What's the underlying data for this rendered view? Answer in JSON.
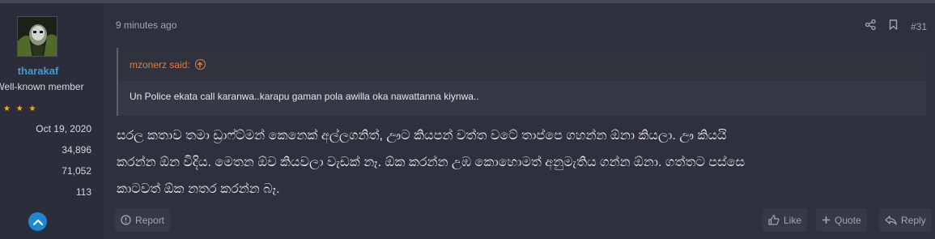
{
  "user": {
    "username": "tharakaf",
    "title": "Well-known member",
    "stars": "★ ★ ★",
    "joined": "Oct 19, 2020",
    "messages": "34,896",
    "reactions": "71,052",
    "points": "113"
  },
  "post": {
    "timestamp": "9 minutes ago",
    "number": "#31",
    "quote": {
      "author": "mzonerz said:",
      "text": "Un Police ekata call karanwa..karapu gaman pola awilla oka nawattanna kiynwa.."
    },
    "body_line1": "සරල කතාව තමා ඩ්‍රාෆ්ට්මන් කෙනෙක් අල්ලගනිත්, ඌට කියපන් වත්ත වටේ තාප්පෙ ගහන්න ඕනා කියලා. ඌ කියයි",
    "body_line2": "කරන්න ඕන විදිය. මෙතන ඕව කියවලා වැඩක් නෑ. ඕක කරන්න උඹ කොහොමත් අනුමැතිය ගන්න ඕනා. ගත්තට පස්සෙ",
    "body_line3": "කාටවත් ඕක නතර කරන්න බෑ."
  },
  "actions": {
    "report": "Report",
    "like": "Like",
    "quote": "Quote",
    "reply": "Reply"
  }
}
